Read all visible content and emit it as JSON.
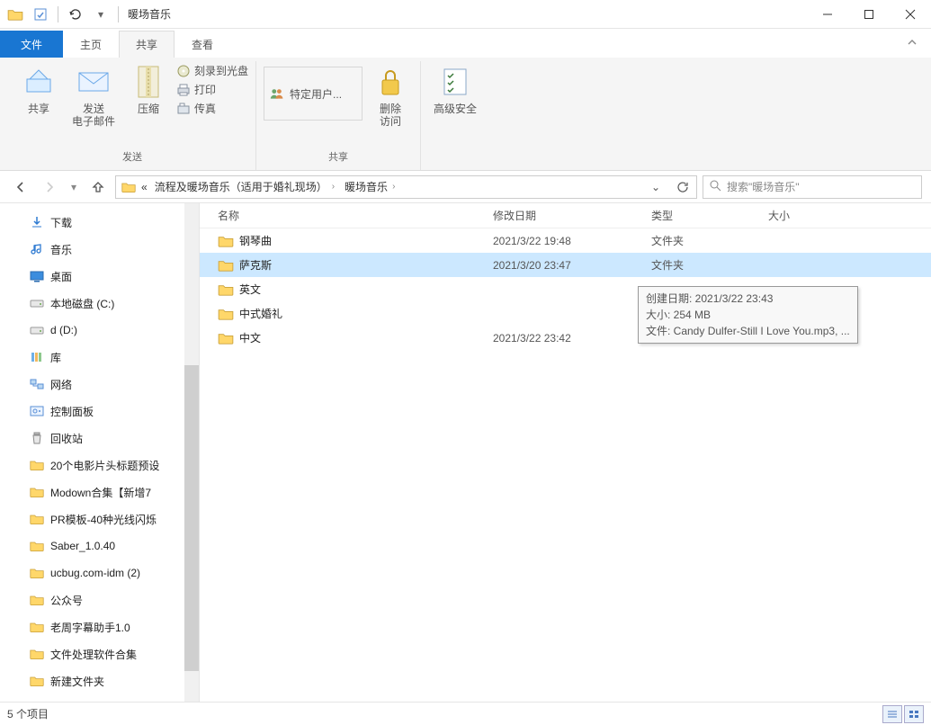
{
  "window": {
    "title": "暖场音乐"
  },
  "tabs": {
    "file": "文件",
    "home": "主页",
    "share": "共享",
    "view": "查看",
    "active": "share"
  },
  "ribbon": {
    "group_send": "发送",
    "group_share": "共享",
    "share_btn": "共享",
    "email_btn": "发送\n电子邮件",
    "compress_btn": "压缩",
    "burn": "刻录到光盘",
    "print": "打印",
    "fax": "传真",
    "spec_user": "特定用户...",
    "remove_access": "删除\n访问",
    "adv_sec": "高级安全"
  },
  "breadcrumb": {
    "parent": "流程及暖场音乐（适用于婚礼现场）",
    "current": "暖场音乐"
  },
  "search": {
    "placeholder": "搜索\"暖场音乐\""
  },
  "nav_items": [
    {
      "label": "下载",
      "kind": "download"
    },
    {
      "label": "音乐",
      "kind": "music"
    },
    {
      "label": "桌面",
      "kind": "desktop"
    },
    {
      "label": "本地磁盘 (C:)",
      "kind": "drive"
    },
    {
      "label": "d (D:)",
      "kind": "drive"
    },
    {
      "label": "库",
      "kind": "lib"
    },
    {
      "label": "网络",
      "kind": "net"
    },
    {
      "label": "控制面板",
      "kind": "ctrl"
    },
    {
      "label": "回收站",
      "kind": "recycle"
    },
    {
      "label": "20个电影片头标题预设",
      "kind": "folder"
    },
    {
      "label": "Modown合集【新增7",
      "kind": "folder"
    },
    {
      "label": "PR模板-40种光线闪烁",
      "kind": "folder"
    },
    {
      "label": "Saber_1.0.40",
      "kind": "folder"
    },
    {
      "label": "ucbug.com-idm (2)",
      "kind": "folder"
    },
    {
      "label": "公众号",
      "kind": "folder"
    },
    {
      "label": "老周字幕助手1.0",
      "kind": "folder"
    },
    {
      "label": "文件处理软件合集",
      "kind": "folder"
    },
    {
      "label": "新建文件夹",
      "kind": "folder"
    }
  ],
  "columns": {
    "name": "名称",
    "date": "修改日期",
    "type": "类型",
    "size": "大小"
  },
  "files": [
    {
      "name": "钢琴曲",
      "date": "2021/3/22 19:48",
      "type": "文件夹",
      "selected": false
    },
    {
      "name": "萨克斯",
      "date": "2021/3/20 23:47",
      "type": "文件夹",
      "selected": true
    },
    {
      "name": "英文",
      "date": "",
      "type": "",
      "selected": false
    },
    {
      "name": "中式婚礼",
      "date": "",
      "type": "",
      "selected": false
    },
    {
      "name": "中文",
      "date": "2021/3/22 23:42",
      "type": "文件夹",
      "selected": false
    }
  ],
  "tooltip": {
    "line1": "创建日期: 2021/3/22 23:43",
    "line2": "大小: 254 MB",
    "line3": "文件: Candy Dulfer-Still I Love You.mp3, ..."
  },
  "status": {
    "text": "5 个项目"
  }
}
